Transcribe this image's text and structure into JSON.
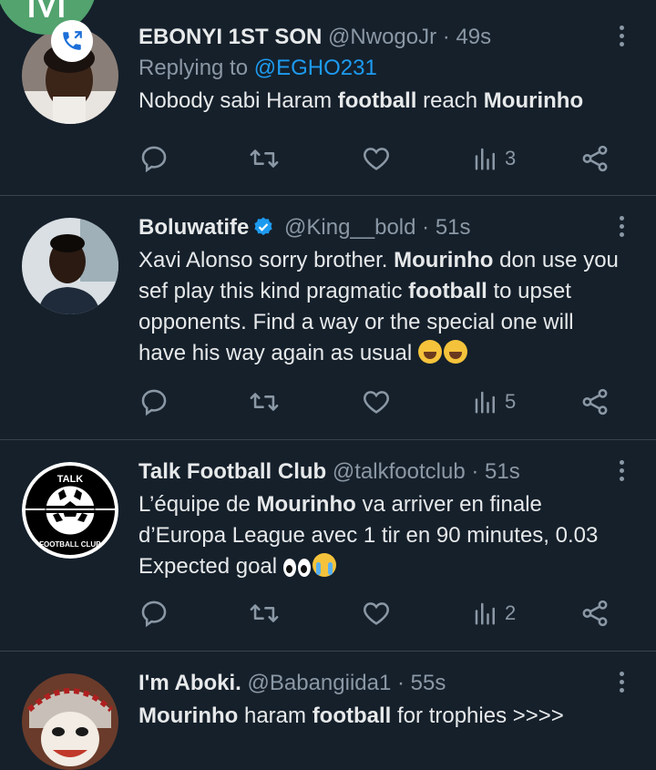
{
  "overlay": {
    "letter": "M"
  },
  "tweets": [
    {
      "name": "EBONYI 1ST SON",
      "handle": "@NwogoJr",
      "time": "49s",
      "replying_prefix": "Replying to",
      "replying_to": "@EGHO231",
      "segments": [
        {
          "t": "Nobody sabi Haram ",
          "b": false
        },
        {
          "t": "football",
          "b": true
        },
        {
          "t": " reach ",
          "b": false
        },
        {
          "t": "Mourinho",
          "b": true
        }
      ],
      "views": "3"
    },
    {
      "name": "Boluwatife",
      "verified": true,
      "handle": "@King__bold",
      "time": "51s",
      "segments": [
        {
          "t": "Xavi Alonso sorry brother. ",
          "b": false
        },
        {
          "t": "Mourinho",
          "b": true
        },
        {
          "t": " don use you sef play this kind pragmatic ",
          "b": false
        },
        {
          "t": "football",
          "b": true
        },
        {
          "t": " to upset opponents. Find a way or the special one will have his way again as usual ",
          "b": false
        }
      ],
      "emoji": [
        "face-with-tears-of-joy",
        "face-with-tears-of-joy"
      ],
      "views": "5"
    },
    {
      "name": "Talk Football Club",
      "handle": "@talkfootclub",
      "time": "51s",
      "avatar_text_top": "TALK",
      "avatar_text_bottom": "FOOTBALL CLUB",
      "segments": [
        {
          "t": "L’équipe de ",
          "b": false
        },
        {
          "t": "Mourinho",
          "b": true
        },
        {
          "t": " va arriver en finale d’Europa League avec 1 tir en 90 minutes, 0.03 Expected goal ",
          "b": false
        }
      ],
      "emoji": [
        "eyes",
        "loudly-crying-face"
      ],
      "views": "2"
    },
    {
      "name": "I'm Aboki.",
      "handle": "@Babangiida1",
      "time": "55s",
      "segments": [
        {
          "t": "Mourinho",
          "b": true
        },
        {
          "t": " haram ",
          "b": false
        },
        {
          "t": "football",
          "b": true
        },
        {
          "t": " for trophies >>>>",
          "b": false
        }
      ]
    }
  ],
  "separator": "·",
  "icons": {
    "reply": "reply-icon",
    "retweet": "retweet-icon",
    "like": "heart-icon",
    "views": "views-icon",
    "share": "share-icon",
    "more": "more-icon",
    "verified": "verified-badge-icon",
    "call": "phone-icon"
  },
  "colors": {
    "background": "#15202b",
    "text": "#e7e9ea",
    "muted": "#8b98a5",
    "link": "#1d9bf0",
    "divider": "#38444d",
    "badge": "#52a36e"
  }
}
